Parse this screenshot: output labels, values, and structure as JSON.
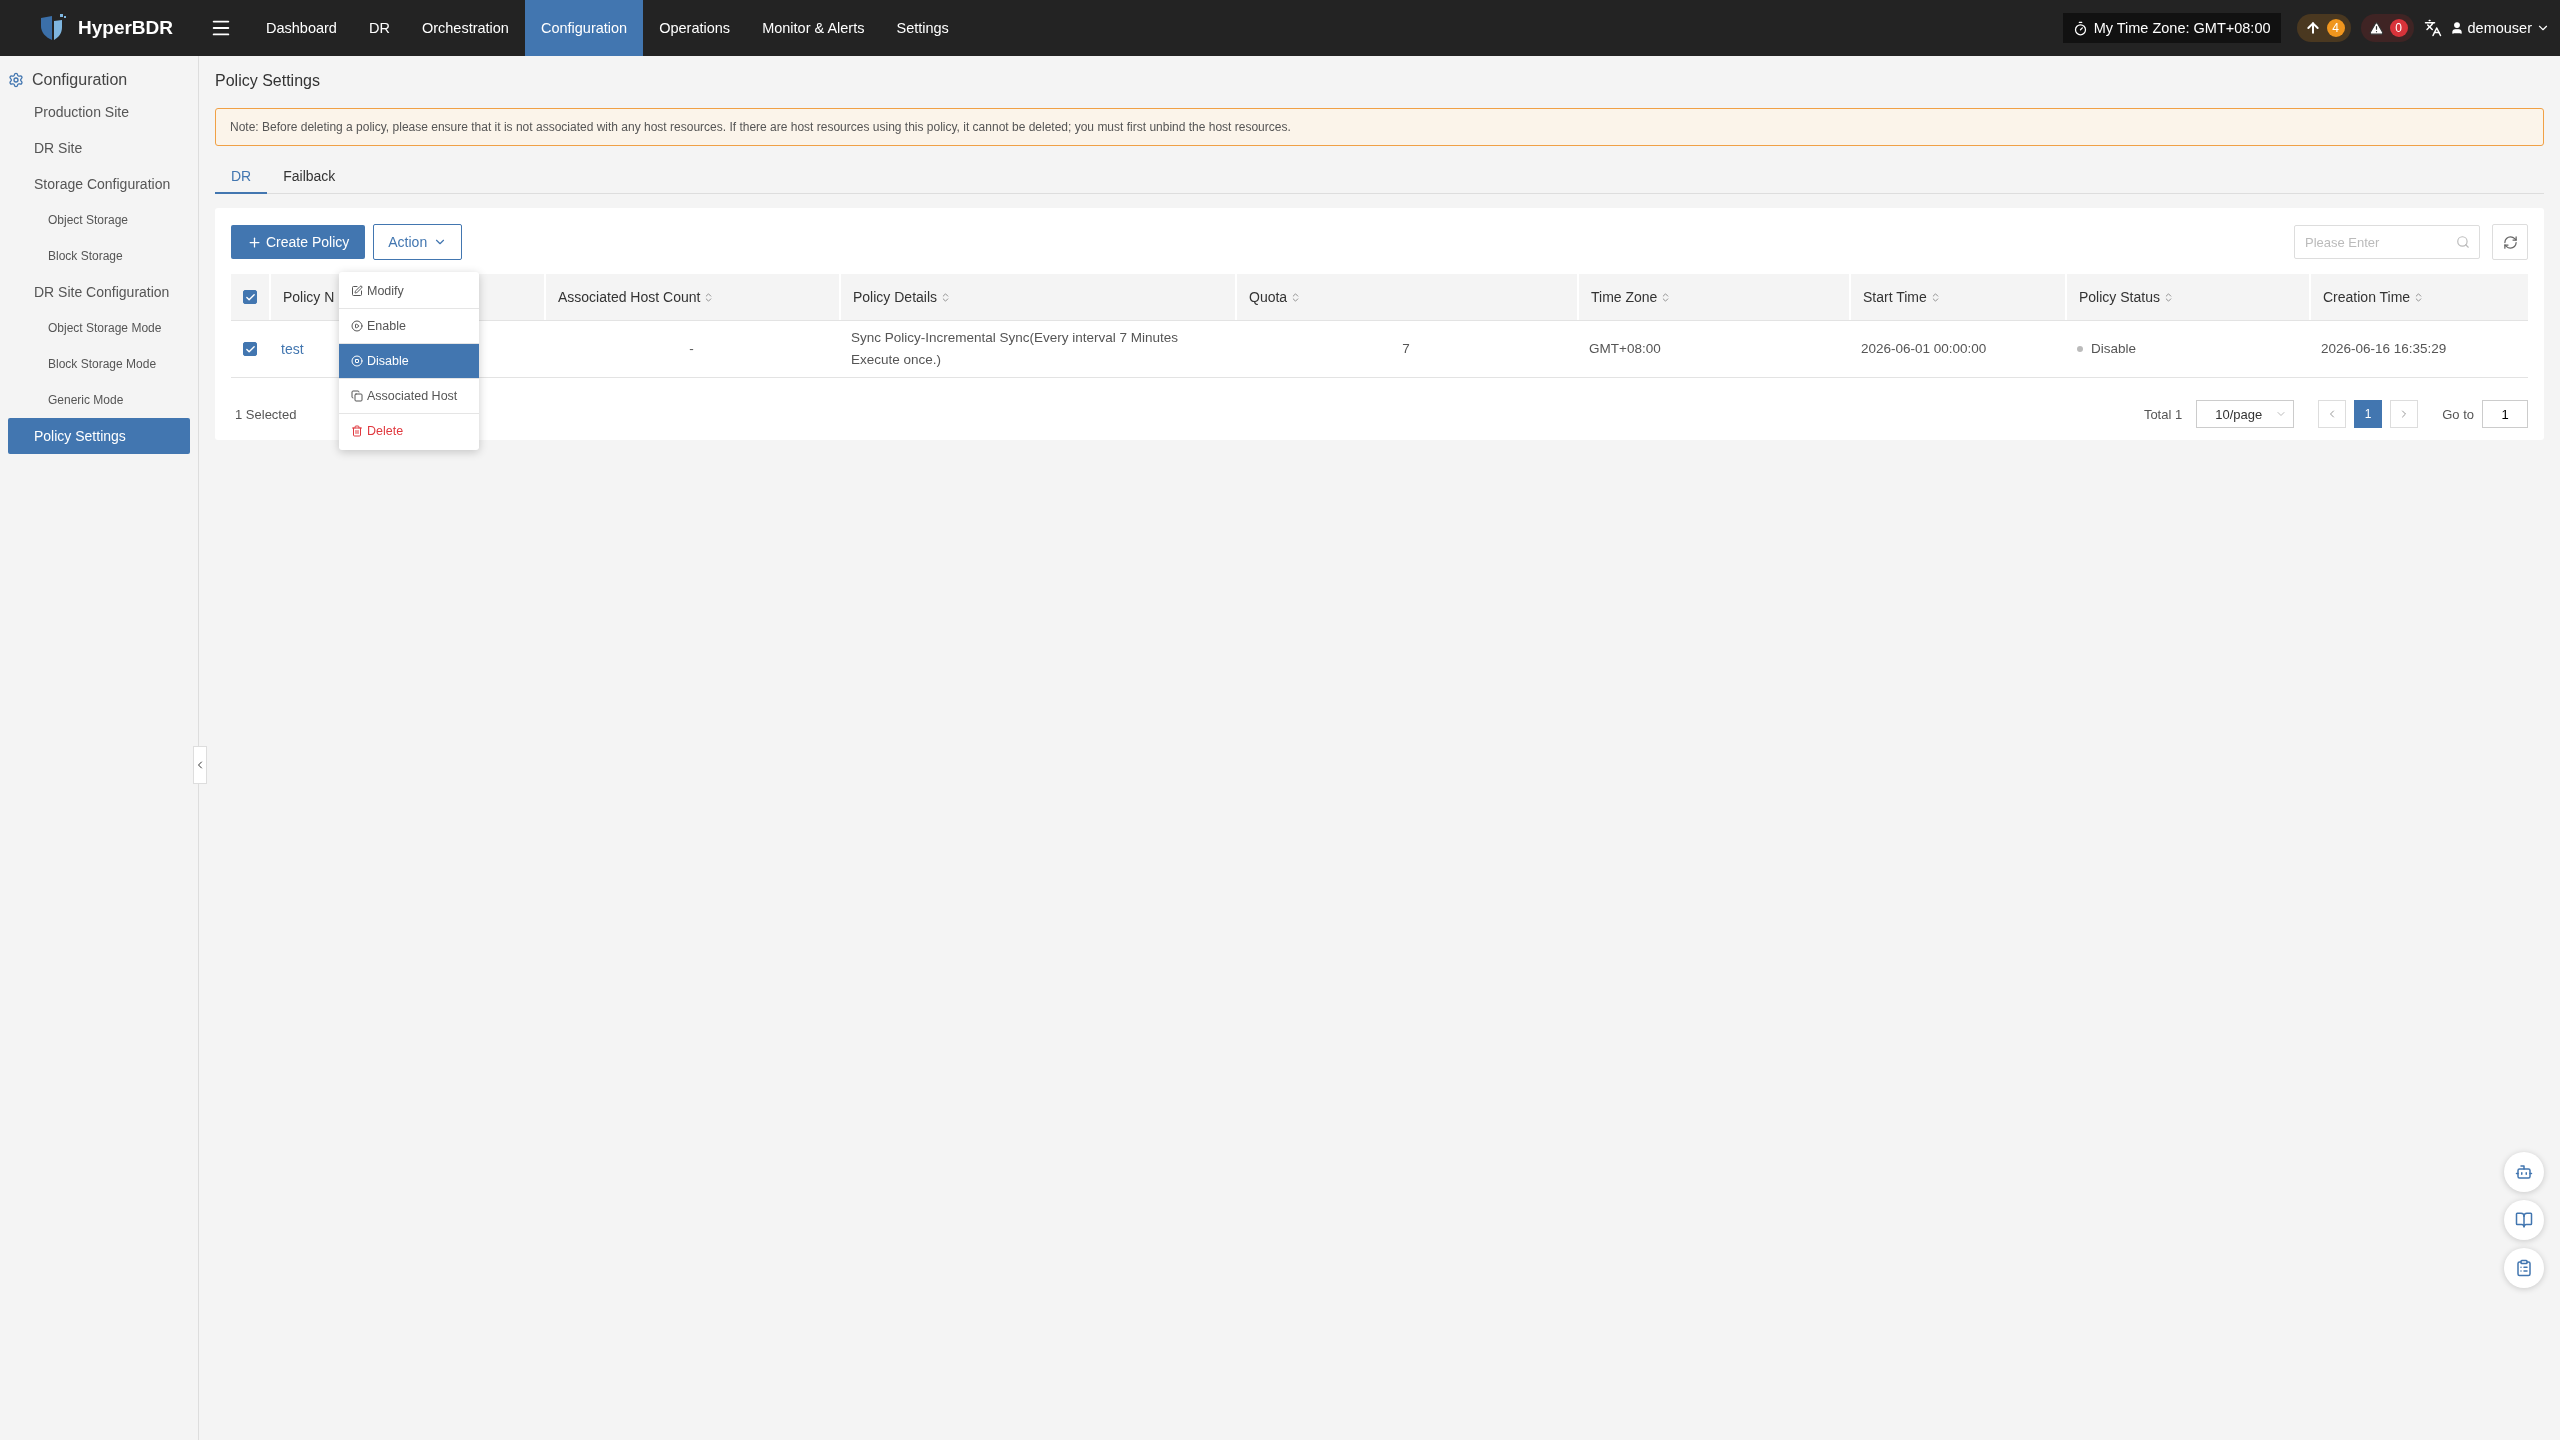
{
  "app": {
    "name": "HyperBDR"
  },
  "nav": [
    {
      "label": "Dashboard",
      "selected": false
    },
    {
      "label": "DR",
      "selected": false
    },
    {
      "label": "Orchestration",
      "selected": false
    },
    {
      "label": "Configuration",
      "selected": true
    },
    {
      "label": "Operations",
      "selected": false
    },
    {
      "label": "Monitor & Alerts",
      "selected": false
    },
    {
      "label": "Settings",
      "selected": false
    }
  ],
  "header": {
    "timezone": "My Time Zone: GMT+08:00",
    "upload_count": "4",
    "alert_count": "0",
    "user": "demouser"
  },
  "sidebar": {
    "title": "Configuration",
    "items": [
      {
        "label": "Production Site",
        "selected": false
      },
      {
        "label": "DR Site",
        "selected": false
      },
      {
        "label": "Storage Configuration",
        "selected": false,
        "children": [
          {
            "label": "Object Storage",
            "selected": false
          },
          {
            "label": "Block Storage",
            "selected": false
          }
        ]
      },
      {
        "label": "DR Site Configuration",
        "selected": false,
        "children": [
          {
            "label": "Object Storage Mode",
            "selected": false
          },
          {
            "label": "Block Storage Mode",
            "selected": false
          },
          {
            "label": "Generic Mode",
            "selected": false
          }
        ]
      },
      {
        "label": "Policy Settings",
        "selected": true
      }
    ]
  },
  "page": {
    "title": "Policy Settings",
    "note": "Note: Before deleting a policy, please ensure that it is not associated with any host resources. If there are host resources using this policy, it cannot be deleted; you must first unbind the host resources.",
    "tabs": [
      {
        "label": "DR",
        "selected": true
      },
      {
        "label": "Failback",
        "selected": false
      }
    ]
  },
  "toolbar": {
    "create_button": "Create Policy",
    "action_button": "Action",
    "search_placeholder": "Please Enter"
  },
  "action_menu": [
    {
      "label": "Modify",
      "kind": "normal",
      "selected": false
    },
    {
      "label": "Enable",
      "kind": "normal",
      "selected": false
    },
    {
      "label": "Disable",
      "kind": "normal",
      "selected": true
    },
    {
      "label": "Associated Host",
      "kind": "normal",
      "selected": false
    },
    {
      "label": "Delete",
      "kind": "danger",
      "selected": false
    }
  ],
  "table": {
    "select_all_checked": true,
    "columns": [
      {
        "label": "Policy N",
        "kind": "link"
      },
      {
        "label": "Associated Host Count",
        "kind": "text",
        "sortable": true
      },
      {
        "label": "Policy Details",
        "kind": "text",
        "sortable": true
      },
      {
        "label": "Quota",
        "kind": "text",
        "sortable": true
      },
      {
        "label": "Time Zone",
        "kind": "text",
        "sortable": true
      },
      {
        "label": "Start Time",
        "kind": "text",
        "sortable": true
      },
      {
        "label": "Policy Status",
        "kind": "status",
        "sortable": true
      },
      {
        "label": "Creation Time",
        "kind": "text",
        "sortable": true
      }
    ],
    "rows": [
      {
        "checked": true,
        "cells": [
          "test",
          "-",
          "Sync Policy-Incremental Sync(Every interval 7 Minutes Execute once.)",
          "7",
          "GMT+08:00",
          "2026-06-01 00:00:00",
          "Disable",
          "2026-06-16 16:35:29"
        ]
      }
    ]
  },
  "footer": {
    "selected": "1 Selected",
    "total": "Total 1",
    "page_size": "10/page",
    "pages": [
      {
        "label": "1",
        "selected": true
      }
    ],
    "goto_label": "Go to",
    "goto_value": "1"
  }
}
